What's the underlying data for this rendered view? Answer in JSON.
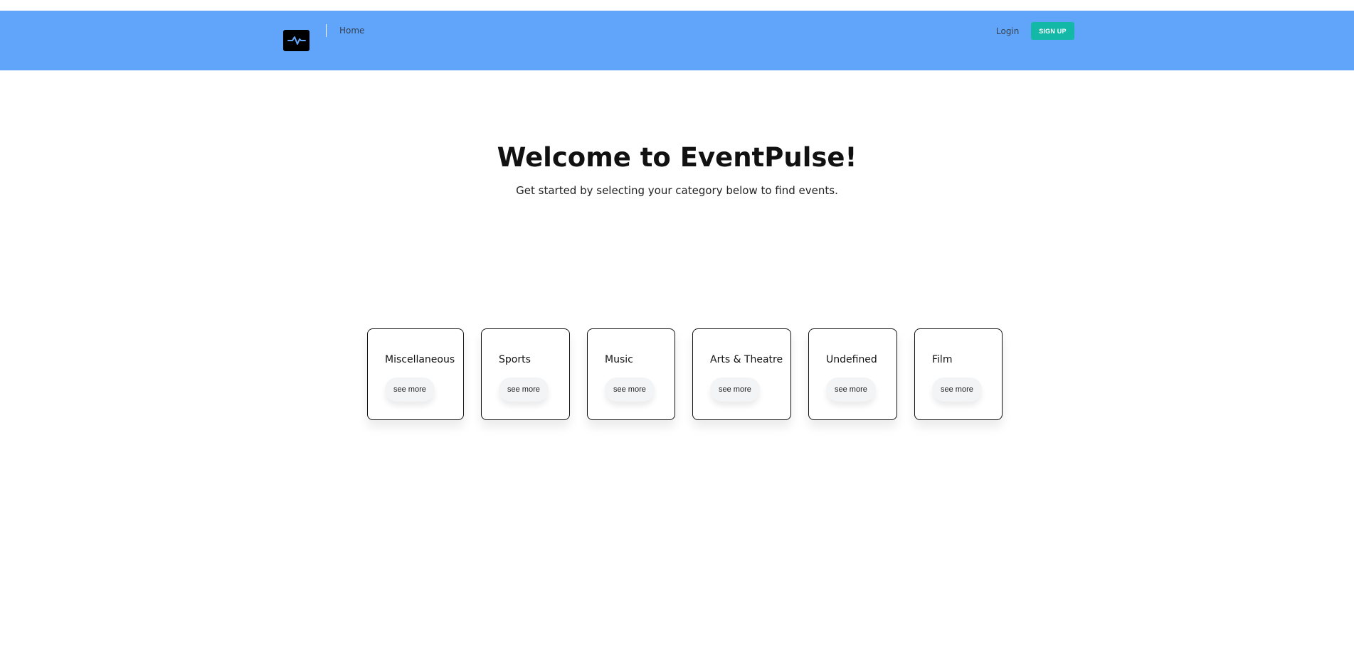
{
  "nav": {
    "home": "Home",
    "login": "Login",
    "signup": "SIGN UP"
  },
  "hero": {
    "title": "Welcome to EventPulse!",
    "subtitle": "Get started by selecting your category below to find events."
  },
  "categories": [
    {
      "name": "Miscellaneous",
      "button": "see more"
    },
    {
      "name": "Sports",
      "button": "see more"
    },
    {
      "name": "Music",
      "button": "see more"
    },
    {
      "name": "Arts & Theatre",
      "button": "see more"
    },
    {
      "name": "Undefined",
      "button": "see more"
    },
    {
      "name": "Film",
      "button": "see more"
    }
  ],
  "colors": {
    "navbar": "#60a5fa",
    "signup": "#14b8a6",
    "logo": "#000000",
    "pulse": "#60a5fa"
  },
  "icons": {
    "logo": "pulse-icon"
  }
}
